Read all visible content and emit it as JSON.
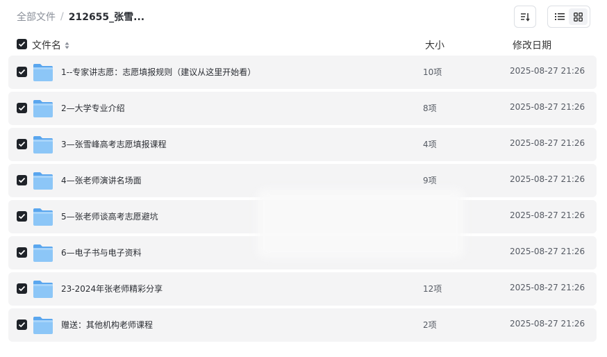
{
  "breadcrumb": {
    "root": "全部文件",
    "separator": "/",
    "current": "212655_张雪..."
  },
  "toolbar": {
    "sort_icon": "sort-icon",
    "list_view_icon": "list-view-icon",
    "grid_view_icon": "grid-view-icon",
    "active_view": "list"
  },
  "table": {
    "headers": {
      "name": "文件名",
      "size": "大小",
      "date": "修改日期"
    },
    "rows": [
      {
        "name": "1--专家讲志愿：志愿填报规则（建议从这里开始看）",
        "size": "10项",
        "date": "2025-08-27 21:26",
        "checked": true
      },
      {
        "name": "2—大学专业介绍",
        "size": "8项",
        "date": "2025-08-27 21:26",
        "checked": true
      },
      {
        "name": "3—张雪峰高考志愿填报课程",
        "size": "4项",
        "date": "2025-08-27 21:26",
        "checked": true
      },
      {
        "name": "4—张老师演讲名场面",
        "size": "9项",
        "date": "2025-08-27 21:26",
        "checked": true
      },
      {
        "name": "5—张老师谈高考志愿避坑",
        "size": "",
        "date": "2025-08-27 21:26",
        "checked": true
      },
      {
        "name": "6—电子书与电子资料",
        "size": "",
        "date": "2025-08-27 21:26",
        "checked": true
      },
      {
        "name": "23-2024年张老师精彩分享",
        "size": "12项",
        "date": "2025-08-27 21:26",
        "checked": true
      },
      {
        "name": "赠送：其他机构老师课程",
        "size": "2项",
        "date": "2025-08-27 21:26",
        "checked": true
      }
    ]
  },
  "colors": {
    "checkbox": "#1f2329",
    "row_bg": "#f4f4f5",
    "folder": "#7cbcf5"
  }
}
